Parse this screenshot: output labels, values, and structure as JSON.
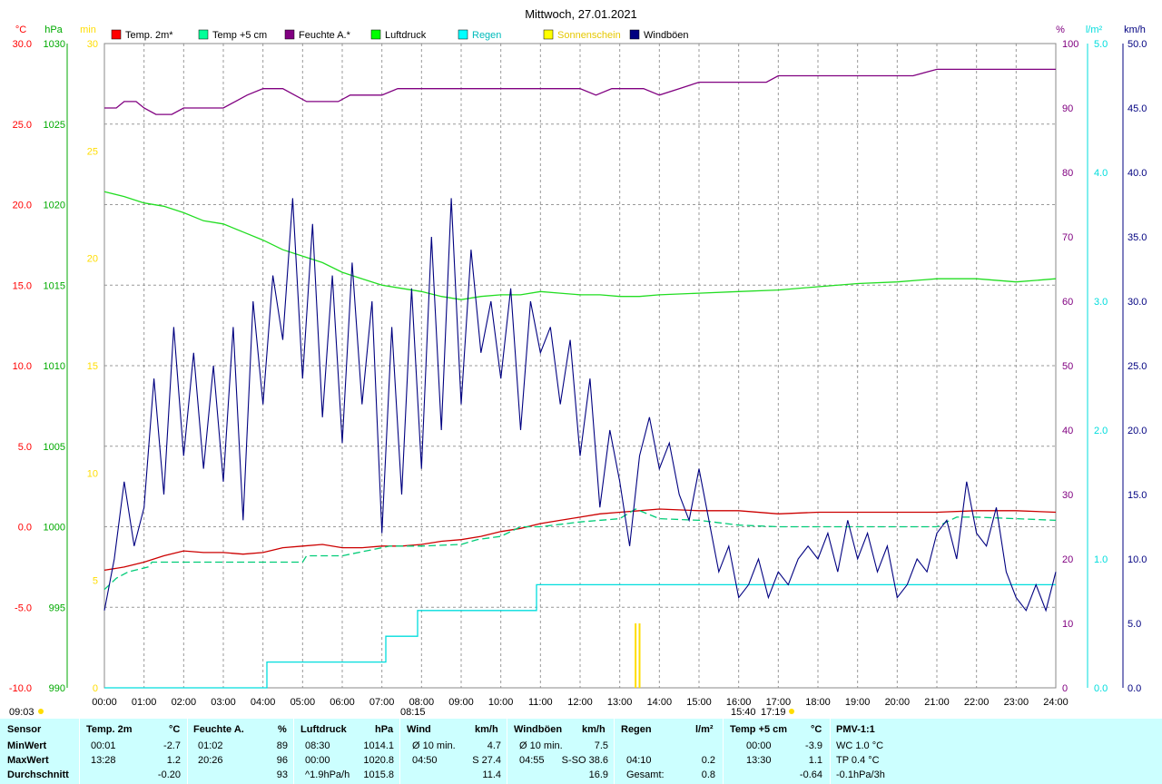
{
  "title": "Mittwoch, 27.01.2021",
  "legend": [
    {
      "label": "Temp. 2m*",
      "color": "#ff0000"
    },
    {
      "label": "Temp +5 cm",
      "color": "#00ff99"
    },
    {
      "label": "Feuchte A.*",
      "color": "#800080"
    },
    {
      "label": "Luftdruck",
      "color": "#00ff00"
    },
    {
      "label": "Regen",
      "color": "#00ffff"
    },
    {
      "label": "Sonnenschein",
      "color": "#ffff00"
    },
    {
      "label": "Windböen",
      "color": "#000080"
    }
  ],
  "axis_units": {
    "temp": "°C",
    "pressure": "hPa",
    "sun": "min",
    "humidity": "%",
    "rain": "l/m²",
    "wind": "km/h"
  },
  "axis_ticks": {
    "temp": [
      "30.0",
      "25.0",
      "20.0",
      "15.0",
      "10.0",
      "5.0",
      "0.0",
      "-5.0",
      "-10.0"
    ],
    "pressure": [
      "1030",
      "1025",
      "1020",
      "1015",
      "1010",
      "1005",
      "1000",
      "995",
      "990"
    ],
    "sun": [
      "30",
      "25",
      "20",
      "15",
      "10",
      "5",
      "0"
    ],
    "humidity": [
      "100",
      "90",
      "80",
      "70",
      "60",
      "50",
      "40",
      "30",
      "20",
      "10",
      "0"
    ],
    "rain": [
      "5.0",
      "4.0",
      "3.0",
      "2.0",
      "1.0",
      "0.0"
    ],
    "wind": [
      "50.0",
      "45.0",
      "40.0",
      "35.0",
      "30.0",
      "25.0",
      "20.0",
      "15.0",
      "10.0",
      "5.0",
      "0.0"
    ]
  },
  "x_ticks": [
    "00:00",
    "01:00",
    "02:00",
    "03:00",
    "04:00",
    "05:00",
    "06:00",
    "07:00",
    "08:00",
    "09:00",
    "10:00",
    "11:00",
    "12:00",
    "13:00",
    "14:00",
    "15:00",
    "16:00",
    "17:00",
    "18:00",
    "19:00",
    "20:00",
    "21:00",
    "22:00",
    "23:00",
    "24:00"
  ],
  "sun_markers": {
    "sunrise": "09:03",
    "sunset": "17:19",
    "noon_a": "08:15",
    "noon_b": "15:40"
  },
  "chart_data": {
    "type": "line",
    "title": "Mittwoch, 27.01.2021",
    "x_unit": "hours",
    "xlim": [
      0,
      24
    ],
    "series": [
      {
        "name": "Temp. 2m*",
        "axis": "temp",
        "ylim": [
          -10,
          30
        ],
        "x": [
          0,
          0.5,
          1,
          1.5,
          2,
          2.5,
          3,
          3.5,
          4,
          4.5,
          5,
          5.5,
          6,
          6.5,
          7,
          7.5,
          8,
          8.5,
          9,
          9.5,
          10,
          10.5,
          11,
          11.5,
          12,
          12.5,
          13,
          13.5,
          14,
          15,
          16,
          17,
          18,
          19,
          20,
          21,
          22,
          23,
          24
        ],
        "y": [
          -2.7,
          -2.5,
          -2.2,
          -1.8,
          -1.5,
          -1.6,
          -1.6,
          -1.7,
          -1.6,
          -1.3,
          -1.2,
          -1.1,
          -1.3,
          -1.3,
          -1.2,
          -1.2,
          -1.1,
          -0.9,
          -0.8,
          -0.6,
          -0.3,
          -0.1,
          0.2,
          0.4,
          0.6,
          0.8,
          0.9,
          1.0,
          1.1,
          1.0,
          1.0,
          0.8,
          0.9,
          0.9,
          0.9,
          0.9,
          1.0,
          1.0,
          0.9
        ]
      },
      {
        "name": "Temp +5 cm",
        "axis": "temp",
        "ylim": [
          -10,
          30
        ],
        "x": [
          0,
          0.3,
          0.6,
          1.1,
          1.2,
          2,
          3,
          4,
          5,
          5.1,
          6,
          7,
          7.2,
          8,
          9,
          9.4,
          10,
          10.5,
          11,
          12,
          13,
          13.4,
          14,
          15,
          16,
          17,
          18,
          19,
          20,
          21,
          21.5,
          22,
          23,
          24
        ],
        "y": [
          -3.9,
          -3.2,
          -2.8,
          -2.5,
          -2.2,
          -2.2,
          -2.2,
          -2.2,
          -2.2,
          -1.8,
          -1.8,
          -1.3,
          -1.2,
          -1.2,
          -1.1,
          -0.8,
          -0.6,
          0.0,
          0.0,
          0.3,
          0.5,
          1.1,
          0.5,
          0.4,
          0.1,
          0.0,
          0.0,
          0.0,
          0.0,
          0.0,
          0.6,
          0.6,
          0.5,
          0.4
        ]
      },
      {
        "name": "Feuchte A.*",
        "axis": "humidity",
        "ylim": [
          0,
          100
        ],
        "x": [
          0,
          0.3,
          0.5,
          0.8,
          1,
          1.3,
          1.7,
          2,
          2.5,
          3,
          3.3,
          3.6,
          4,
          4.5,
          4.8,
          5.1,
          5.6,
          5.9,
          6.2,
          7,
          7.4,
          8,
          9,
          10,
          11,
          11.3,
          12,
          12.4,
          12.8,
          13,
          13.6,
          14,
          14.5,
          15,
          16,
          16.7,
          17,
          17.6,
          18,
          19,
          20,
          20.4,
          21,
          21.4,
          22,
          23,
          24
        ],
        "y": [
          90,
          90,
          91,
          91,
          90,
          89,
          89,
          90,
          90,
          90,
          91,
          92,
          93,
          93,
          92,
          91,
          91,
          91,
          92,
          92,
          93,
          93,
          93,
          93,
          93,
          93,
          93,
          92,
          93,
          93,
          93,
          92,
          93,
          94,
          94,
          94,
          95,
          95,
          95,
          95,
          95,
          95,
          96,
          96,
          96,
          96,
          96
        ]
      },
      {
        "name": "Luftdruck",
        "axis": "pressure",
        "ylim": [
          990,
          1030
        ],
        "x": [
          0,
          0.5,
          1,
          1.5,
          2,
          2.5,
          3,
          3.5,
          4,
          4.5,
          5,
          5.5,
          6,
          6.5,
          7,
          7.5,
          8,
          8.5,
          9,
          9.5,
          10,
          10.5,
          11,
          11.5,
          12,
          12.5,
          13,
          13.5,
          14,
          15,
          16,
          17,
          18,
          19,
          20,
          21,
          22,
          23,
          24
        ],
        "y": [
          1020.8,
          1020.5,
          1020.1,
          1019.9,
          1019.5,
          1019.0,
          1018.8,
          1018.3,
          1017.8,
          1017.2,
          1016.8,
          1016.4,
          1015.8,
          1015.4,
          1015.0,
          1014.8,
          1014.6,
          1014.3,
          1014.1,
          1014.3,
          1014.4,
          1014.4,
          1014.6,
          1014.5,
          1014.4,
          1014.4,
          1014.3,
          1014.3,
          1014.4,
          1014.5,
          1014.6,
          1014.7,
          1014.9,
          1015.1,
          1015.2,
          1015.4,
          1015.4,
          1015.2,
          1015.4
        ]
      },
      {
        "name": "Regen",
        "axis": "rain",
        "ylim": [
          0,
          5
        ],
        "step": true,
        "x": [
          0,
          4.1,
          4.1,
          7.1,
          7.1,
          7.9,
          7.9,
          10.9,
          10.9,
          24
        ],
        "y": [
          0,
          0,
          0.2,
          0.2,
          0.4,
          0.4,
          0.6,
          0.6,
          0.8,
          0.8
        ]
      },
      {
        "name": "Sonnenschein",
        "axis": "sun",
        "ylim": [
          0,
          30
        ],
        "bars": true,
        "x": [
          13.4,
          13.5
        ],
        "y": [
          3,
          3
        ]
      },
      {
        "name": "Windböen",
        "axis": "wind",
        "ylim": [
          0,
          50
        ],
        "x": [
          0,
          0.25,
          0.5,
          0.75,
          1,
          1.25,
          1.5,
          1.75,
          2,
          2.25,
          2.5,
          2.75,
          3,
          3.25,
          3.5,
          3.75,
          4,
          4.25,
          4.5,
          4.75,
          5,
          5.25,
          5.5,
          5.75,
          6,
          6.25,
          6.5,
          6.75,
          7,
          7.25,
          7.5,
          7.75,
          8,
          8.25,
          8.5,
          8.75,
          9,
          9.25,
          9.5,
          9.75,
          10,
          10.25,
          10.5,
          10.75,
          11,
          11.25,
          11.5,
          11.75,
          12,
          12.25,
          12.5,
          12.75,
          13,
          13.25,
          13.5,
          13.75,
          14,
          14.25,
          14.5,
          14.75,
          15,
          15.25,
          15.5,
          15.75,
          16,
          16.25,
          16.5,
          16.75,
          17,
          17.25,
          17.5,
          17.75,
          18,
          18.25,
          18.5,
          18.75,
          19,
          19.25,
          19.5,
          19.75,
          20,
          20.25,
          20.5,
          20.75,
          21,
          21.25,
          21.5,
          21.75,
          22,
          22.25,
          22.5,
          22.75,
          23,
          23.25,
          23.5,
          23.75,
          24
        ],
        "y": [
          6,
          10,
          16,
          11,
          14,
          24,
          15,
          28,
          18,
          26,
          17,
          25,
          16,
          28,
          13,
          30,
          22,
          32,
          27,
          38,
          24,
          36,
          21,
          32,
          19,
          33,
          22,
          30,
          12,
          28,
          15,
          31,
          17,
          35,
          20,
          38,
          22,
          34,
          26,
          30,
          24,
          31,
          20,
          30,
          26,
          28,
          22,
          27,
          18,
          24,
          14,
          20,
          16,
          11,
          18,
          21,
          17,
          19,
          15,
          13,
          17,
          13,
          9,
          11,
          7,
          8,
          10,
          7,
          9,
          8,
          10,
          11,
          10,
          12,
          9,
          13,
          10,
          12,
          9,
          11,
          7,
          8,
          10,
          9,
          12,
          13,
          10,
          16,
          12,
          11,
          14,
          9,
          7,
          6,
          8,
          6,
          9
        ]
      }
    ]
  },
  "stats": {
    "headers": [
      {
        "label": "Sensor",
        "unit": ""
      },
      {
        "label": "Temp. 2m",
        "unit": "°C"
      },
      {
        "label": "Feuchte A.",
        "unit": "%"
      },
      {
        "label": "Luftdruck",
        "unit": "hPa"
      },
      {
        "label": "Wind",
        "unit": "km/h"
      },
      {
        "label": "Windböen",
        "unit": "km/h"
      },
      {
        "label": "Regen",
        "unit": "l/m²"
      },
      {
        "label": "Temp +5 cm",
        "unit": "°C"
      },
      {
        "label": "PMV-1:1",
        "unit": ""
      }
    ],
    "row_labels": [
      "MinWert",
      "MaxWert",
      "Durchschnitt"
    ],
    "rows": [
      [
        [
          "00:01",
          "-2.7"
        ],
        [
          "01:02",
          "89"
        ],
        [
          "08:30",
          "1014.1"
        ],
        [
          "Ø 10 min.",
          "4.7"
        ],
        [
          "Ø 10 min.",
          "7.5"
        ],
        [
          "",
          ""
        ],
        [
          "00:00",
          "-3.9"
        ],
        [
          "WC 1.0 °C",
          ""
        ]
      ],
      [
        [
          "13:28",
          "1.2"
        ],
        [
          "20:26",
          "96"
        ],
        [
          "00:00",
          "1020.8"
        ],
        [
          "04:50",
          "S 27.4"
        ],
        [
          "04:55",
          "S-SO 38.6"
        ],
        [
          "04:10",
          "0.2"
        ],
        [
          "13:30",
          "1.1"
        ],
        [
          "TP 0.4 °C",
          ""
        ]
      ],
      [
        [
          "",
          "-0.20"
        ],
        [
          "",
          "93"
        ],
        [
          "^1.9hPa/h",
          "1015.8"
        ],
        [
          "",
          "11.4"
        ],
        [
          "",
          "16.9"
        ],
        [
          "Gesamt:",
          "0.8"
        ],
        [
          "",
          "-0.64"
        ],
        [
          "-0.1hPa/3h",
          ""
        ]
      ]
    ]
  },
  "colors": {
    "temp_axis": "#ff0000",
    "pressure_axis": "#00aa00",
    "sun_axis": "#ffdd00",
    "humidity_axis": "#800080",
    "rain_axis": "#00dddd",
    "wind_axis": "#000080",
    "stats_bg": "#ccffff"
  }
}
